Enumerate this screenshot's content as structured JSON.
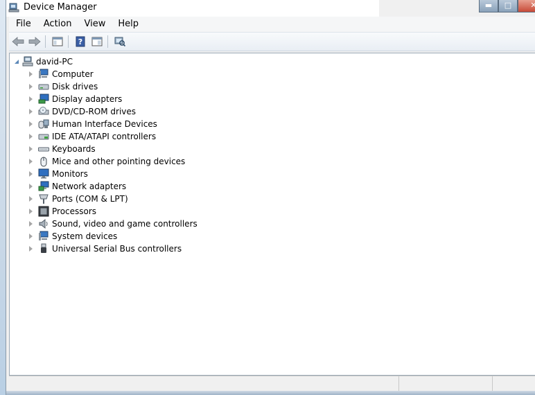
{
  "window": {
    "title": "Device Manager",
    "controls": {
      "minimize": "▬",
      "maximize": "□",
      "close": "✕"
    }
  },
  "menu": [
    "File",
    "Action",
    "View",
    "Help"
  ],
  "toolbar": {
    "buttons": [
      "back-arrow-icon",
      "forward-arrow-icon",
      "properties-pane-icon",
      "help-icon",
      "console-icon",
      "scan-hardware-icon"
    ]
  },
  "tree": {
    "root": "david-PC",
    "items": [
      {
        "label": "Computer",
        "icon": "computer-icon"
      },
      {
        "label": "Disk drives",
        "icon": "disk-drive-icon"
      },
      {
        "label": "Display adapters",
        "icon": "display-adapter-icon"
      },
      {
        "label": "DVD/CD-ROM drives",
        "icon": "dvd-drive-icon"
      },
      {
        "label": "Human Interface Devices",
        "icon": "hid-icon"
      },
      {
        "label": "IDE ATA/ATAPI controllers",
        "icon": "ide-controller-icon"
      },
      {
        "label": "Keyboards",
        "icon": "keyboard-icon"
      },
      {
        "label": "Mice and other pointing devices",
        "icon": "mouse-icon"
      },
      {
        "label": "Monitors",
        "icon": "monitor-icon"
      },
      {
        "label": "Network adapters",
        "icon": "network-adapter-icon"
      },
      {
        "label": "Ports (COM & LPT)",
        "icon": "port-icon"
      },
      {
        "label": "Processors",
        "icon": "processor-icon"
      },
      {
        "label": "Sound, video and game controllers",
        "icon": "sound-icon"
      },
      {
        "label": "System devices",
        "icon": "system-device-icon"
      },
      {
        "label": "Universal Serial Bus controllers",
        "icon": "usb-icon"
      }
    ]
  }
}
